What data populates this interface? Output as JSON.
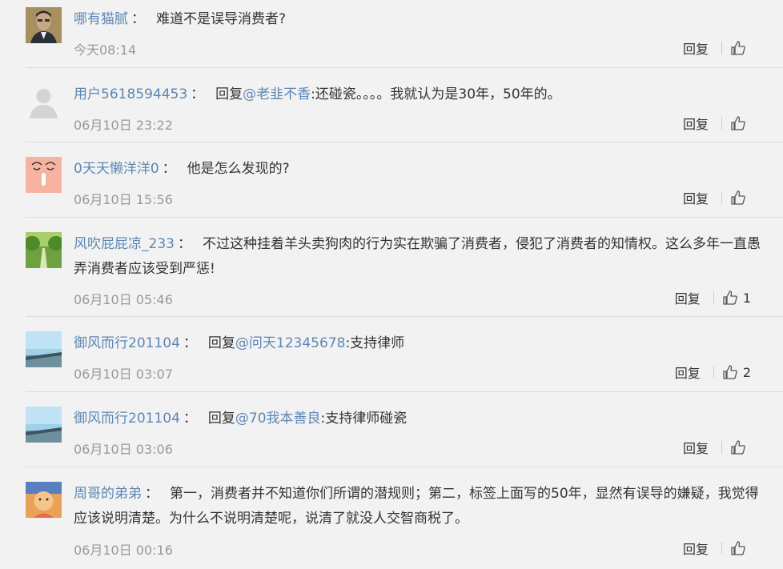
{
  "comments": [
    {
      "user": "哪有猫腻",
      "colon": "：",
      "prefix": "",
      "mention": "",
      "text": "难道不是误导消费者?",
      "time": "今天08:14",
      "reply_label": "回复",
      "likes": "",
      "avatar_icon": "portrait-man-avatar"
    },
    {
      "user": "用户5618594453",
      "colon": "：",
      "prefix": "回复",
      "mention": "@老韭不香",
      "text": ":还碰瓷。。。。我就认为是30年，50年的。",
      "time": "06月10日 23:22",
      "reply_label": "回复",
      "likes": "",
      "avatar_icon": "default-user-avatar"
    },
    {
      "user": "0天天懒洋洋0",
      "colon": "：",
      "prefix": "",
      "mention": "",
      "text": "他是怎么发现的?",
      "time": "06月10日 15:56",
      "reply_label": "回复",
      "likes": "",
      "avatar_icon": "cartoon-face-avatar"
    },
    {
      "user": "风吹屁屁凉_233",
      "colon": "：",
      "prefix": "",
      "mention": "",
      "text": "不过这种挂着羊头卖狗肉的行为实在欺骗了消费者，侵犯了消费者的知情权。这么多年一直愚弄消费者应该受到严惩!",
      "time": "06月10日 05:46",
      "reply_label": "回复",
      "likes": "1",
      "avatar_icon": "tree-road-avatar"
    },
    {
      "user": "御风而行201104",
      "colon": "：",
      "prefix": "回复",
      "mention": "@问天12345678",
      "text": ":支持律师",
      "time": "06月10日 03:07",
      "reply_label": "回复",
      "likes": "2",
      "avatar_icon": "sky-landscape-avatar"
    },
    {
      "user": "御风而行201104",
      "colon": "：",
      "prefix": "回复",
      "mention": "@70我本善良",
      "text": ":支持律师碰瓷",
      "time": "06月10日 03:06",
      "reply_label": "回复",
      "likes": "",
      "avatar_icon": "sky-landscape-avatar"
    },
    {
      "user": "周哥的弟弟",
      "colon": "：",
      "prefix": "",
      "mention": "",
      "text": "第一，消费者并不知道你们所谓的潜规则；第二，标签上面写的50年，显然有误导的嫌疑，我觉得应该说明清楚。为什么不说明清楚呢，说清了就没人交智商税了。",
      "time": "06月10日 00:16",
      "reply_label": "回复",
      "likes": "",
      "avatar_icon": "colorful-face-avatar"
    }
  ]
}
